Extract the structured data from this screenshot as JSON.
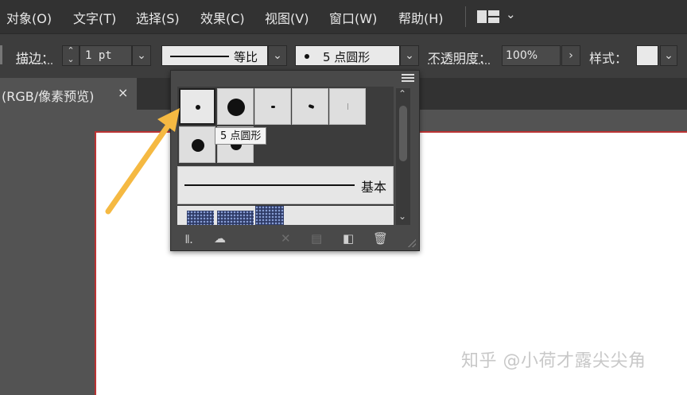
{
  "menubar": {
    "items": [
      "对象(O)",
      "文字(T)",
      "选择(S)",
      "效果(C)",
      "视图(V)",
      "窗口(W)",
      "帮助(H)"
    ],
    "workspace_icon": "workspace-switcher-icon",
    "chevron_icon": "chevron-down-icon"
  },
  "controlbar": {
    "stroke_label": "描边：",
    "stroke_value": "1 pt",
    "profile_label": "等比",
    "brush_value": "5 点圆形",
    "opacity_label": "不透明度：",
    "opacity_value": "100%",
    "style_label": "样式："
  },
  "tab": {
    "label": "(RGB/像素预览)",
    "close": "×"
  },
  "brush_panel": {
    "tooltip": "5 点圆形",
    "basic_label": "基本",
    "footer_icons": [
      "brush-library-icon",
      "creative-cloud-libraries-icon",
      "remove-stroke-icon",
      "options-icon",
      "new-brush-icon",
      "delete-brush-icon"
    ]
  },
  "watermark": "知乎 @小荷才露尖尖角",
  "colors": {
    "menubar_bg": "#323232",
    "controlbar_bg": "#3d3d3d",
    "canvas_bg": "#535353",
    "artboard_border": "#bb3333",
    "arrow": "#f5b942"
  }
}
